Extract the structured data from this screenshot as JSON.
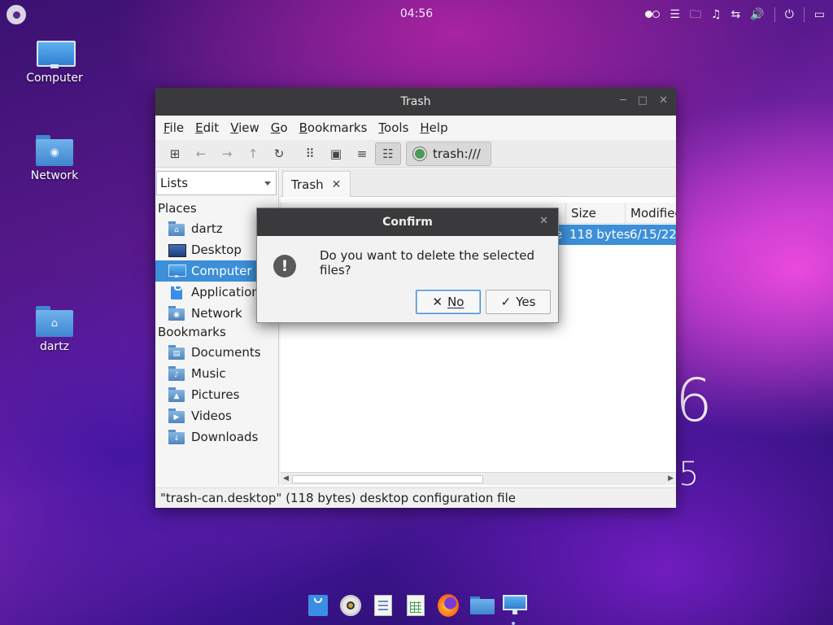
{
  "panel": {
    "clock": "04:56",
    "tray_icons": [
      "toggle-dots-icon",
      "menu-lines-icon",
      "folder-outline-icon",
      "bell-icon",
      "network-arrows-icon",
      "volume-icon",
      "power-icon",
      "layout-icon"
    ]
  },
  "desktop": {
    "icons": [
      {
        "label": "Computer",
        "icon": "computer-icon"
      },
      {
        "label": "Network",
        "icon": "network-folder-icon"
      },
      {
        "label": "dartz",
        "icon": "home-folder-icon"
      }
    ],
    "deco_clock": {
      "digit_top": "6",
      "digit_bottom": "5"
    }
  },
  "window": {
    "title": "Trash",
    "menu": [
      "File",
      "Edit",
      "View",
      "Go",
      "Bookmarks",
      "Tools",
      "Help"
    ],
    "menu_underline": [
      "F",
      "E",
      "V",
      "G",
      "B",
      "T",
      "H"
    ],
    "location": "trash:///",
    "side_combo": "Lists",
    "places_header": "Places",
    "places": [
      {
        "label": "dartz",
        "icon": "home-folder-icon"
      },
      {
        "label": "Desktop",
        "icon": "desktop-icon"
      },
      {
        "label": "Computer",
        "icon": "computer-icon",
        "selected": true
      },
      {
        "label": "Applications",
        "icon": "applications-bag-icon"
      },
      {
        "label": "Network",
        "icon": "network-icon"
      }
    ],
    "bookmarks_header": "Bookmarks",
    "bookmarks": [
      {
        "label": "Documents",
        "icon": "documents-folder-icon"
      },
      {
        "label": "Music",
        "icon": "music-folder-icon"
      },
      {
        "label": "Pictures",
        "icon": "pictures-folder-icon"
      },
      {
        "label": "Videos",
        "icon": "videos-folder-icon"
      },
      {
        "label": "Downloads",
        "icon": "downloads-folder-icon"
      }
    ],
    "tab": {
      "label": "Trash"
    },
    "columns": {
      "size": "Size",
      "modified": "Modified"
    },
    "row": {
      "name_tail": "e",
      "size": "118 bytes",
      "modified": "6/15/22"
    },
    "status": "\"trash-can.desktop\" (118 bytes) desktop configuration file"
  },
  "dialog": {
    "title": "Confirm",
    "message": "Do you want to delete the selected files?",
    "no_label": "No",
    "yes_label": "Yes"
  },
  "dock": {
    "items": [
      "software-center-icon",
      "media-player-icon",
      "text-editor-icon",
      "spreadsheet-icon",
      "firefox-icon",
      "file-manager-icon",
      "computer-icon"
    ]
  },
  "colors": {
    "selection": "#3c8fd8",
    "titlebar": "#3a3a3c"
  }
}
